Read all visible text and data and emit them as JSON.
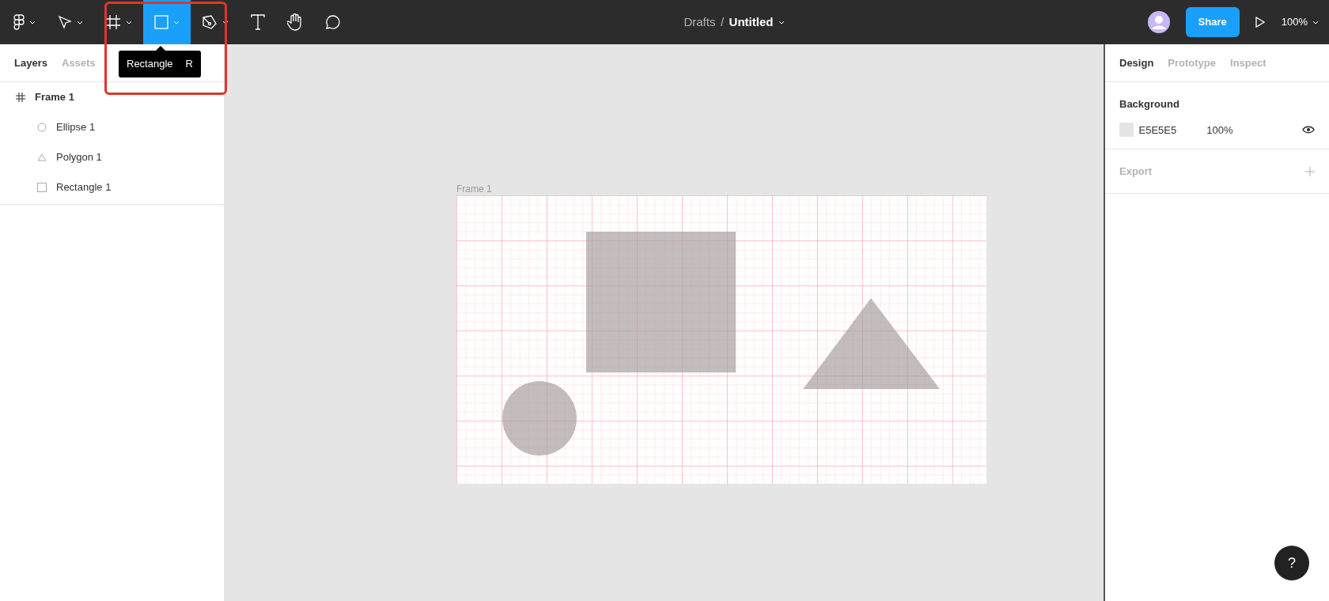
{
  "toolbar": {
    "tools": [
      {
        "kind": "logo",
        "selected": false,
        "dropdown": true
      },
      {
        "kind": "move",
        "selected": false,
        "dropdown": true
      },
      {
        "kind": "frame",
        "selected": false,
        "dropdown": true
      },
      {
        "kind": "rectangle",
        "selected": true,
        "dropdown": true
      },
      {
        "kind": "pen",
        "selected": false,
        "dropdown": true
      },
      {
        "kind": "text",
        "selected": false,
        "dropdown": false
      },
      {
        "kind": "hand",
        "selected": false,
        "dropdown": false
      },
      {
        "kind": "comment",
        "selected": false,
        "dropdown": false
      }
    ],
    "breadcrumb": {
      "folder": "Drafts",
      "separator": "/",
      "file": "Untitled"
    },
    "share": "Share",
    "zoom": "100%"
  },
  "tooltip": {
    "label": "Rectangle",
    "shortcut": "R"
  },
  "left_panel": {
    "tabs": [
      {
        "label": "Layers",
        "selected": true
      },
      {
        "label": "Assets",
        "selected": false
      }
    ],
    "layers": [
      {
        "kind": "frame",
        "name": "Frame 1",
        "children": [
          {
            "kind": "ellipse",
            "name": "Ellipse 1"
          },
          {
            "kind": "polygon",
            "name": "Polygon 1"
          },
          {
            "kind": "rectangle",
            "name": "Rectangle 1"
          }
        ]
      }
    ]
  },
  "canvas": {
    "frame": {
      "name": "Frame 1",
      "shapes": [
        {
          "kind": "rectangle"
        },
        {
          "kind": "polygon"
        },
        {
          "kind": "ellipse"
        }
      ]
    }
  },
  "right_panel": {
    "tabs": [
      {
        "label": "Design",
        "selected": true
      },
      {
        "label": "Prototype",
        "selected": false
      },
      {
        "label": "Inspect",
        "selected": false
      }
    ],
    "background": {
      "title": "Background",
      "color": "#e5e5e5",
      "hex": "E5E5E5",
      "opacity": "100%"
    },
    "export": {
      "title": "Export"
    }
  },
  "help": "?"
}
